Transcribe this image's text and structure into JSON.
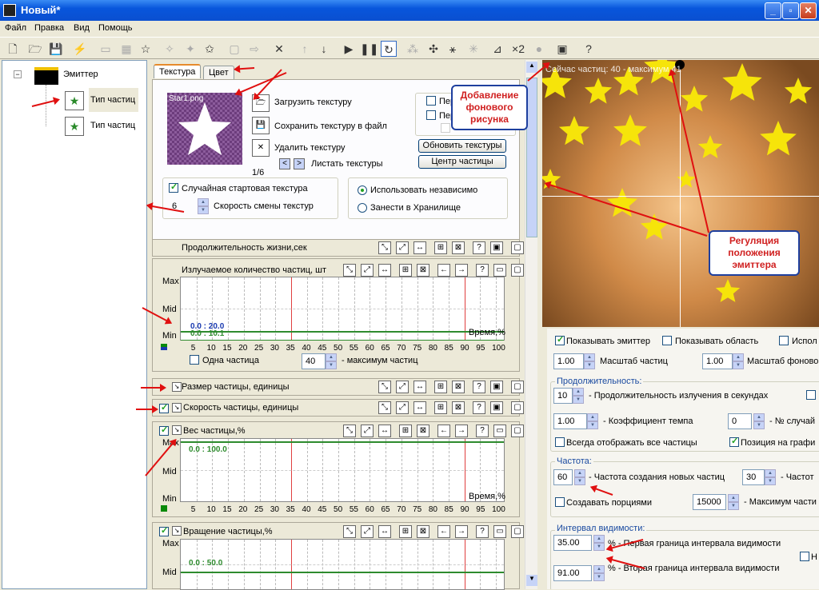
{
  "window": {
    "title": "Новый*"
  },
  "menu": [
    "Файл",
    "Правка",
    "Вид",
    "Помощь"
  ],
  "tree": {
    "root": "Эмиттер",
    "items": [
      "Тип частиц",
      "Тип частиц"
    ]
  },
  "texture": {
    "tabs": [
      "Текстура",
      "Цвет"
    ],
    "filename": "Star1.png",
    "counter": "1/6",
    "load": "Загрузить текстуру",
    "save": "Сохранить текстуру в файл",
    "delete": "Удалить текстуру",
    "browse": "Листать текстуры",
    "update_btn": "Обновить текстуры",
    "center_btn": "Центр частицы",
    "chk1": "Пер",
    "chk2": "Пер",
    "random_start": "Случайная стартовая текстура",
    "speed_value": "6",
    "speed_label": "Скорость смены текстур",
    "radio_independent": "Использовать независимо",
    "radio_storage": "Занести в Хранилище"
  },
  "sections": {
    "lifetime": "Продолжительность жизни,сек",
    "emission": "Излучаемое количество частиц, шт",
    "size": "Размер частицы, единицы",
    "speed": "Скорость частицы, единицы",
    "weight": "Вес частицы,%",
    "rotation": "Вращение частицы,%"
  },
  "chart_axes": {
    "max": "Max",
    "mid": "Mid",
    "min": "Min",
    "time": "Время,%",
    "ticks": [
      "5",
      "10",
      "15",
      "20",
      "25",
      "30",
      "35",
      "40",
      "45",
      "50",
      "55",
      "60",
      "65",
      "70",
      "75",
      "80",
      "85",
      "90",
      "95",
      "100"
    ]
  },
  "emission_chart": {
    "label1": "0.0 : 20.0",
    "label2": "0.0 : 10.1",
    "single": "Одна частица",
    "max_value": "40",
    "max_label": "- максимум частиц"
  },
  "weight_chart": {
    "label": "0.0 : 100.0"
  },
  "rotation_chart": {
    "label": "0.0 : 50.0"
  },
  "preview": {
    "status": "Сейчас частиц: 40 - максимум 41"
  },
  "props": {
    "show_emitter": "Показывать эмиттер",
    "show_area": "Показывать область",
    "use_cut": "Испол",
    "scale_val": "1.00",
    "scale_label": "Масштаб частиц",
    "bgscale_val": "1.00",
    "bgscale_label": "Масштаб фоново",
    "duration_group": "Продолжительность:",
    "emit_val": "10",
    "emit_label": "- Продолжительность излучения в секундах",
    "tempo_val": "1.00",
    "tempo_label": "- Коэффициент темпа",
    "rand_val": "0",
    "rand_label": "- № случай",
    "always_show": "Всегда отображать все частицы",
    "pos_graph": "Позиция на графи",
    "freq_group": "Частота:",
    "freq_val": "60",
    "freq_label": "- Частота создания новых частиц",
    "freq2_val": "30",
    "freq2_label": "- Частот",
    "portions": "Создавать порциями",
    "portions_val": "15000",
    "portions_label": "- Максимум части",
    "vis_group": "Интервал видимости:",
    "vis1_val": "35.00",
    "vis1_label": "% - Первая граница интервала видимости",
    "vis2_val": "91.00",
    "vis2_label": "% - Вторая граница интервала видимости",
    "vis_h": "Н"
  },
  "callouts": {
    "background": "Добавление фонового рисунка",
    "emitter": "Регуляция положения эмиттера"
  },
  "colors": {
    "title_bar": "#0a4fd0",
    "chart_line": "#2e8b2e",
    "accent_red": "#e01010",
    "callout_border": "#1e3f9e"
  }
}
